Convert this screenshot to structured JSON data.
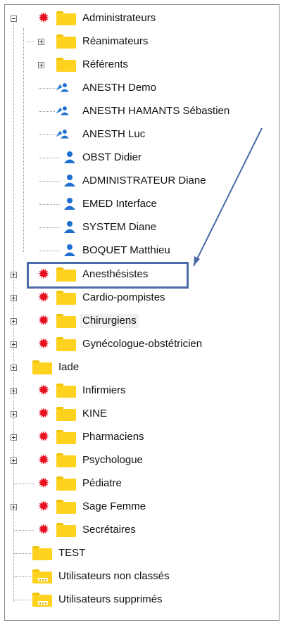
{
  "tree": {
    "administrateurs": {
      "label": "Administrateurs"
    },
    "reanimateurs": {
      "label": "Réanimateurs"
    },
    "referents": {
      "label": "Référents"
    },
    "users": [
      {
        "label": "ANESTH Demo"
      },
      {
        "label": "ANESTH HAMANTS Sébastien"
      },
      {
        "label": "ANESTH Luc"
      },
      {
        "label": "OBST Didier"
      },
      {
        "label": "ADMINISTRATEUR Diane"
      },
      {
        "label": "EMED Interface"
      },
      {
        "label": "SYSTEM Diane"
      },
      {
        "label": "BOQUET Matthieu"
      }
    ],
    "groups": [
      {
        "label": "Anesthésistes"
      },
      {
        "label": "Cardio-pompistes"
      },
      {
        "label": "Chirurgiens"
      },
      {
        "label": "Gynécologue-obstétricien"
      },
      {
        "label": "Iade"
      },
      {
        "label": "Infirmiers"
      },
      {
        "label": "KINE"
      },
      {
        "label": "Pharmaciens"
      },
      {
        "label": "Psychologue"
      },
      {
        "label": "Pédiatre"
      },
      {
        "label": "Sage Femme"
      },
      {
        "label": "Secrétaires"
      },
      {
        "label": "TEST"
      },
      {
        "label": "Utilisateurs non classés"
      },
      {
        "label": "Utilisateurs supprimés"
      }
    ]
  },
  "colors": {
    "gear": "#e8101f",
    "folder": "#ffd21f",
    "callout": "#4a6aa8"
  }
}
